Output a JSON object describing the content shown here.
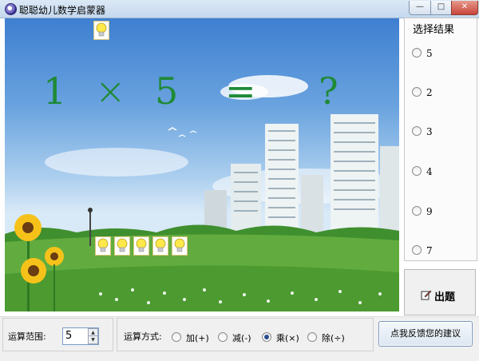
{
  "window": {
    "title": "聪聪幼儿数学启蒙器",
    "min_glyph": "—",
    "max_glyph": "□",
    "close_glyph": "✕"
  },
  "equation": {
    "operand_a": "1",
    "operator": "×",
    "operand_b": "5",
    "equals": "=",
    "unknown": "?"
  },
  "scene": {
    "bulb_count": 5
  },
  "results": {
    "title": "选择结果",
    "options": [
      "5",
      "2",
      "3",
      "4",
      "9",
      "7"
    ]
  },
  "quiz_button": {
    "label": "出题"
  },
  "bottom": {
    "range_label": "运算范围:",
    "range_value": "5",
    "mode_label": "运算方式:",
    "modes": [
      "加(+)",
      "减(-)",
      "乘(×)",
      "除(÷)"
    ],
    "selected_mode": "乘(×)",
    "feedback_label": "点我反馈您的建议"
  },
  "colors": {
    "equation": "#1f8a36",
    "sky": "#6aa3df",
    "grass": "#5aa43a"
  }
}
